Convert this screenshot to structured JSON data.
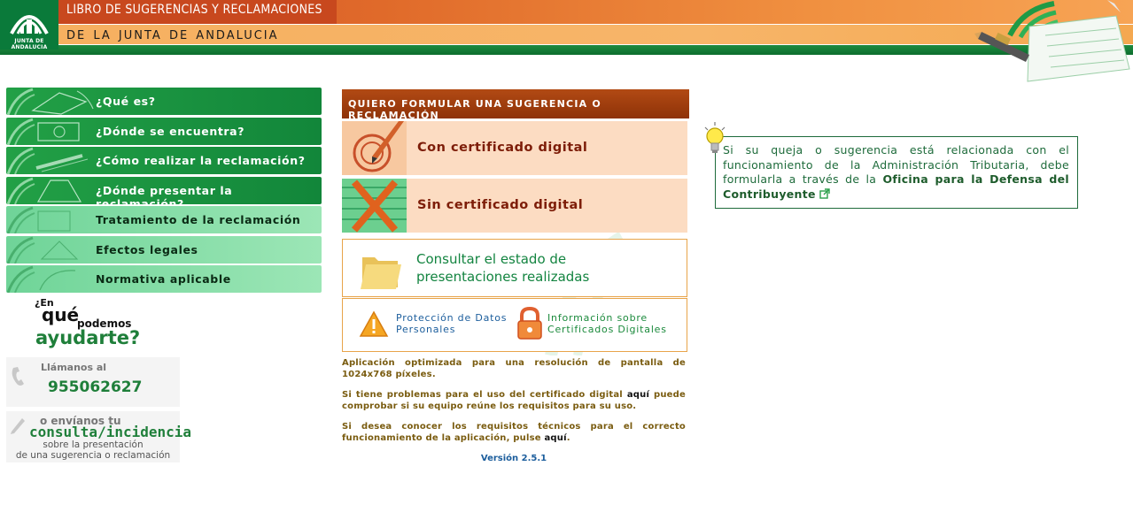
{
  "header": {
    "logo_text": "JUNTA DE ANDALUCIA",
    "title": "LIBRO DE SUGERENCIAS Y RECLAMACIONES",
    "subtitle": "DE LA JUNTA DE ANDALUCIA"
  },
  "menu": {
    "items": [
      {
        "label": "¿Qué es?",
        "style": "dark"
      },
      {
        "label": "¿Dónde se encuentra?",
        "style": "dark"
      },
      {
        "label": "¿Cómo realizar la reclamación?",
        "style": "dark"
      },
      {
        "label": "¿Dónde presentar la reclamación?",
        "style": "dark"
      },
      {
        "label": "Tratamiento de la reclamación",
        "style": "light"
      },
      {
        "label": "Efectos legales",
        "style": "light"
      },
      {
        "label": "Normativa aplicable",
        "style": "light"
      }
    ]
  },
  "help": {
    "q1": "¿En",
    "q2": "qué",
    "q3": "podemos",
    "q4": "ayudarte?",
    "call_label": "Llámanos al",
    "phone": "955062627",
    "mail_label": "o envíanos tu",
    "mail_link": "consulta/incidencia",
    "mail_desc_1": "sobre la presentación",
    "mail_desc_2": "de una sugerencia o reclamación"
  },
  "center": {
    "header": "QUIERO FORMULAR UNA SUGERENCIA O RECLAMACIÓN",
    "with_cert": "Con certificado digital",
    "without_cert": "Sin certificado digital",
    "consult_line1": "Consultar el estado de",
    "consult_line2": "presentaciones realizadas",
    "data_protection_1": "Protección de Datos",
    "data_protection_2": "Personales",
    "cert_info_1": "Información sobre",
    "cert_info_2": "Certificados Digitales",
    "info_optimized": "Aplicación optimizada para una resolución de pantalla de 1024x768 píxeles.",
    "info_cert_a": "Si tiene problemas para el uso del certificado digital ",
    "info_cert_link": "aquí",
    "info_cert_b": " puede comprobar si su equipo reúne los requisitos para su uso.",
    "info_req_a": "Si desea conocer los requisitos técnicos para el correcto funcionamiento de la aplicación, pulse ",
    "info_req_link": "aquí",
    "info_req_b": ".",
    "version": "Versión 2.5.1"
  },
  "note": {
    "text": "Si su queja o sugerencia está relacionada con el funcionamiento de la Administración Tributaria, debe formularla a través de la ",
    "link": "Oficina para la Defensa del Contribuyente"
  },
  "colors": {
    "brand_green": "#0a7a3a",
    "header_orange": "#e06a2a",
    "cert_bg": "#fcdcc2",
    "note_green": "#1e6b3b"
  }
}
